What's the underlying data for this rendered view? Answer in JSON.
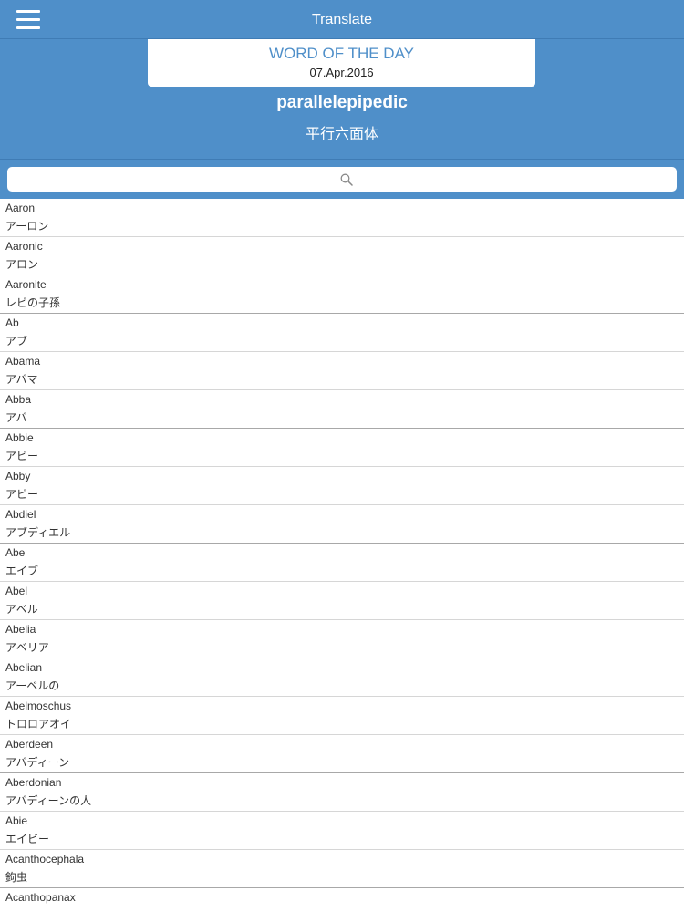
{
  "app": {
    "title": "Translate"
  },
  "word_of_the_day": {
    "heading": "WORD OF THE DAY",
    "date": "07.Apr.2016",
    "word": "parallelepipedic",
    "translation": "平行六面体"
  },
  "search": {
    "icon": "search-icon",
    "value": ""
  },
  "colors": {
    "header": "#4f8fc9",
    "heading_text": "#4f8fc9"
  },
  "entries": [
    {
      "word": "Aaron",
      "translation": "アーロン"
    },
    {
      "word": "Aaronic",
      "translation": "アロン"
    },
    {
      "word": "Aaronite",
      "translation": "レビの子孫"
    },
    {
      "word": "Ab",
      "translation": "アブ"
    },
    {
      "word": "Abama",
      "translation": "アバマ"
    },
    {
      "word": "Abba",
      "translation": "アバ"
    },
    {
      "word": "Abbie",
      "translation": "アビー"
    },
    {
      "word": "Abby",
      "translation": "アビー"
    },
    {
      "word": "Abdiel",
      "translation": "アブディエル"
    },
    {
      "word": "Abe",
      "translation": "エイブ"
    },
    {
      "word": "Abel",
      "translation": "アベル"
    },
    {
      "word": "Abelia",
      "translation": "アベリア"
    },
    {
      "word": "Abelian",
      "translation": "アーベルの"
    },
    {
      "word": "Abelmoschus",
      "translation": "トロロアオイ"
    },
    {
      "word": "Aberdeen",
      "translation": "アバディーン"
    },
    {
      "word": "Aberdonian",
      "translation": "アバディーンの人"
    },
    {
      "word": "Abie",
      "translation": "エイビー"
    },
    {
      "word": "Acanthocephala",
      "translation": "鉤虫"
    },
    {
      "word": "Acanthopanax",
      "translation": ""
    }
  ]
}
